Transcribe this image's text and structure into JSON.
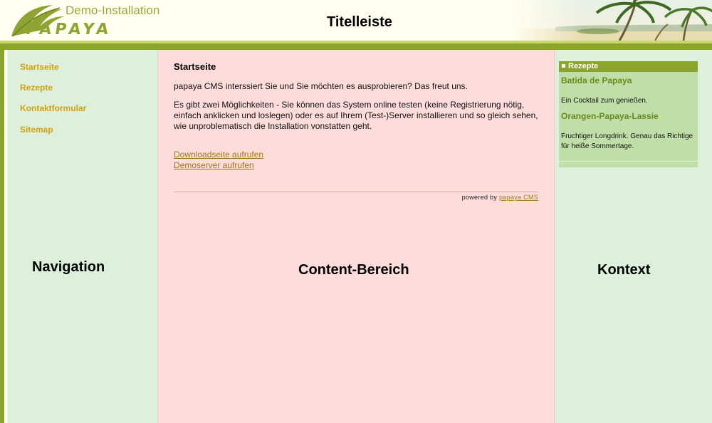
{
  "header": {
    "logo_top": "Demo-Installation",
    "logo_brand": "PAPAYA",
    "region_label": "Titelleiste"
  },
  "navigation": {
    "items": [
      {
        "label": "Startseite"
      },
      {
        "label": "Rezepte"
      },
      {
        "label": "Kontaktformular"
      },
      {
        "label": "Sitemap"
      }
    ],
    "region_label": "Navigation"
  },
  "content": {
    "heading": "Startseite",
    "paragraph1": "papaya CMS interssiert Sie und Sie möchten es ausprobieren? Das freut uns.",
    "paragraph2": "Es gibt zwei Möglichkeiten - Sie können das System online testen (keine Registrierung nötig, einfach anklicken und loslegen) oder es auf Ihrem (Test-)Server installieren und so gleich sehen, wie unproblematisch die Installation vonstatten geht.",
    "links": [
      {
        "label": "Downloadseite aufrufen"
      },
      {
        "label": "Demoserver aufrufen"
      }
    ],
    "powered_prefix": "powered by",
    "powered_link": "papaya CMS",
    "region_label": "Content-Bereich"
  },
  "context": {
    "box_title": "Rezepte",
    "items": [
      {
        "title": "Batida de Papaya",
        "description": "Ein Cocktail zum genießen."
      },
      {
        "title": "Orangen-Papaya-Lassie",
        "description": "Fruchtiger Longdrink. Genau das Richtige für heiße Sommertage."
      }
    ],
    "region_label": "Kontext"
  },
  "colors": {
    "accent_green": "#8ca42c",
    "nav_link": "#d4a010",
    "content_bg": "#ffdcdc",
    "sidebar_bg": "#dcf0dc"
  }
}
